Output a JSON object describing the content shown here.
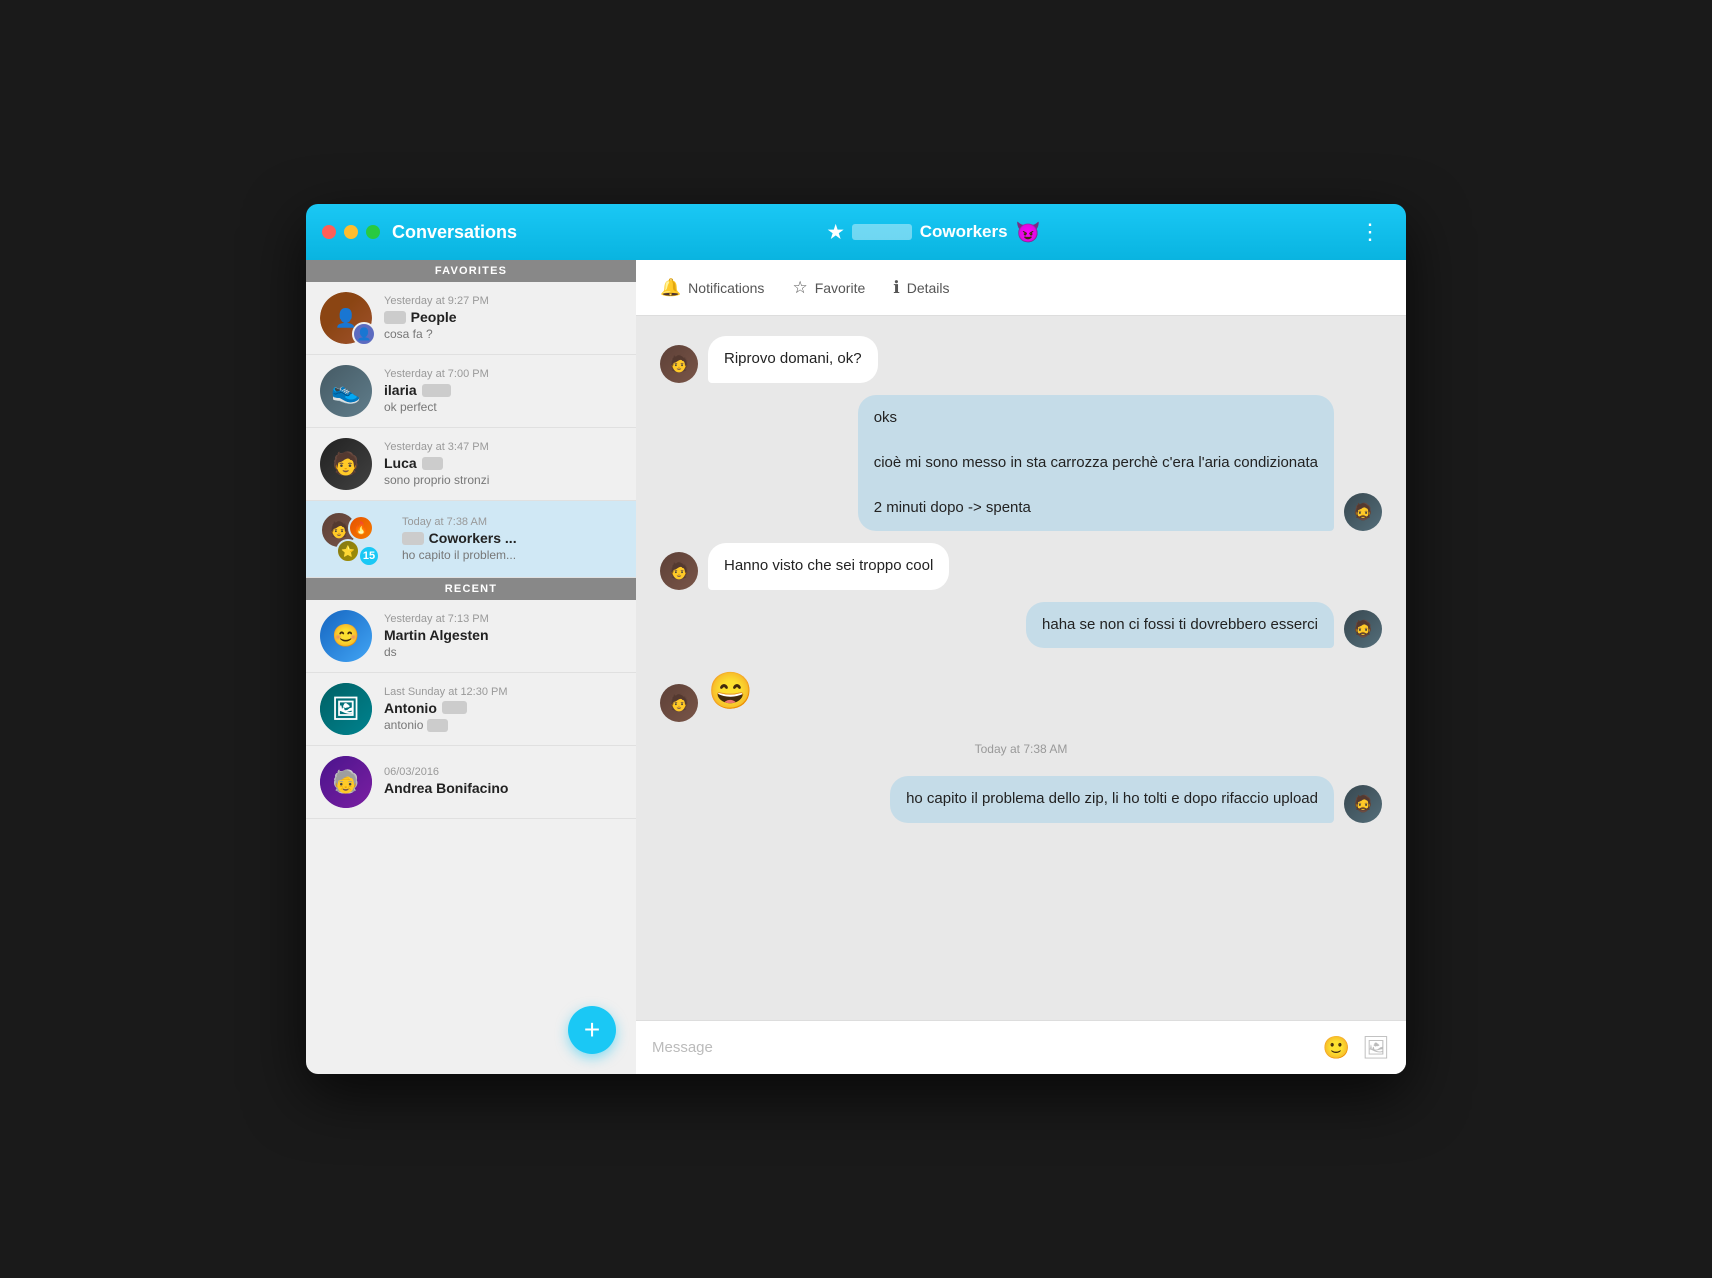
{
  "window": {
    "title": "Conversations",
    "chat_title": "Coworkers",
    "chat_emoji": "😈",
    "star_char": "★"
  },
  "toolbar": {
    "notifications_label": "Notifications",
    "favorite_label": "Favorite",
    "details_label": "Details"
  },
  "sidebar": {
    "favorites_label": "FAVORITES",
    "recent_label": "RECENT",
    "conversations": [
      {
        "id": "people",
        "time": "Yesterday at 9:27 PM",
        "name": "People",
        "preview": "cosa fa ?",
        "active": false,
        "badge": null
      },
      {
        "id": "ilaria",
        "time": "Yesterday at 7:00 PM",
        "name": "ilaria",
        "preview": "ok perfect",
        "active": false,
        "badge": null
      },
      {
        "id": "luca",
        "time": "Yesterday at 3:47 PM",
        "name": "Luca",
        "preview": "sono proprio stronzi",
        "active": false,
        "badge": null
      },
      {
        "id": "coworkers",
        "time": "Today at 7:38 AM",
        "name": "Coworkers ...",
        "preview": "ho capito il problem...",
        "active": true,
        "badge": "15"
      }
    ],
    "recent_conversations": [
      {
        "id": "martin",
        "time": "Yesterday at 7:13 PM",
        "name": "Martin Algesten",
        "preview": "ds",
        "active": false,
        "badge": null
      },
      {
        "id": "antonio",
        "time": "Last Sunday at 12:30 PM",
        "name": "Antonio",
        "preview": "antonio",
        "active": false,
        "badge": null
      },
      {
        "id": "andrea",
        "time": "06/03/2016",
        "name": "Andrea Bonifacino",
        "preview": "",
        "active": false,
        "badge": null
      }
    ],
    "fab_label": "+"
  },
  "messages": [
    {
      "id": "msg1",
      "type": "incoming",
      "text": "Riprovo domani, ok?",
      "avatar": "in"
    },
    {
      "id": "msg2",
      "type": "outgoing",
      "text": "oks\n\ncioè mi sono messo in sta carrozza perchè c'era l'aria condizionata\n\n2 minuti dopo -> spenta",
      "avatar": "out"
    },
    {
      "id": "msg3",
      "type": "incoming",
      "text": "Hanno visto che sei troppo cool",
      "avatar": "in"
    },
    {
      "id": "msg4",
      "type": "outgoing",
      "text": "haha se non ci fossi ti dovrebbero esserci",
      "avatar": "out"
    },
    {
      "id": "msg5",
      "type": "incoming",
      "text": "😄",
      "avatar": "in",
      "emoji_only": true
    },
    {
      "id": "ts1",
      "type": "timestamp",
      "text": "Today at 7:38 AM"
    },
    {
      "id": "msg6",
      "type": "outgoing",
      "text": "ho capito il problema dello zip, li ho tolti e dopo rifaccio upload",
      "avatar": "out"
    }
  ],
  "input": {
    "placeholder": "Message"
  }
}
